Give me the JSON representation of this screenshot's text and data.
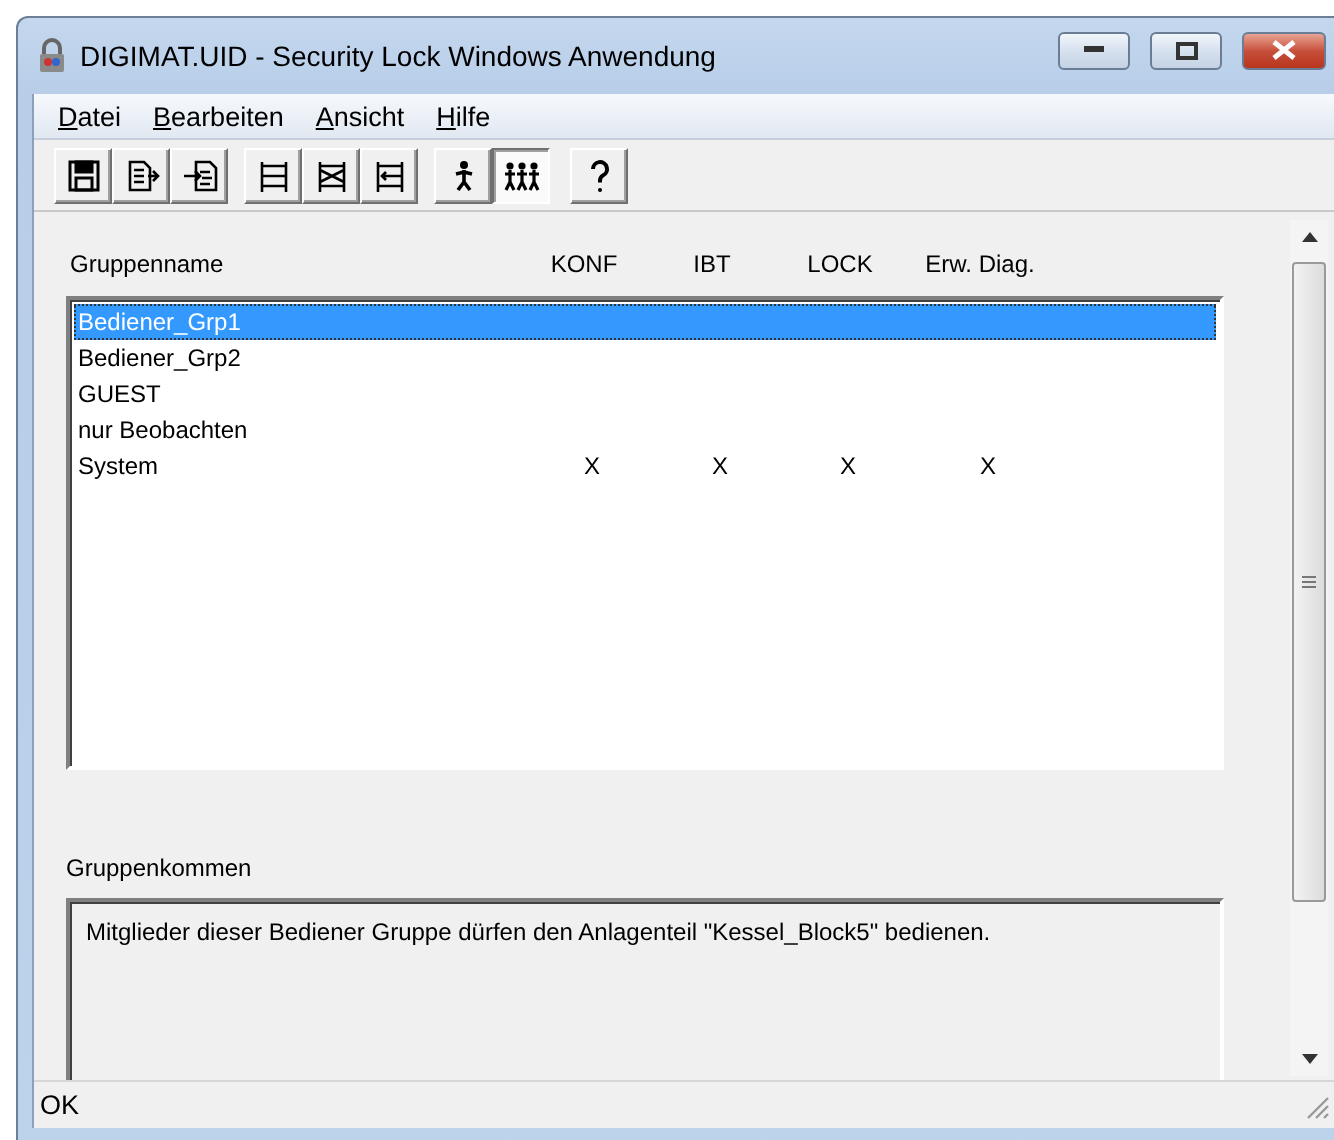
{
  "window": {
    "title": "DIGIMAT.UID - Security Lock Windows Anwendung"
  },
  "menu": [
    "Datei",
    "Bearbeiten",
    "Ansicht",
    "Hilfe"
  ],
  "toolbar": [
    {
      "kind": "save",
      "pressed": false
    },
    {
      "kind": "export",
      "pressed": false
    },
    {
      "kind": "import",
      "pressed": false
    },
    {
      "kind": "table-a",
      "pressed": false
    },
    {
      "kind": "table-b",
      "pressed": false
    },
    {
      "kind": "table-c",
      "pressed": false
    },
    {
      "kind": "user",
      "pressed": false
    },
    {
      "kind": "group",
      "pressed": true
    },
    {
      "kind": "help",
      "pressed": false
    }
  ],
  "table": {
    "columns": [
      "Gruppenname",
      "KONF",
      "IBT",
      "LOCK",
      "Erw. Diag."
    ],
    "rows": [
      {
        "cells": [
          "Bediener_Grp1",
          "",
          "",
          "",
          ""
        ],
        "selected": true
      },
      {
        "cells": [
          "Bediener_Grp2",
          "",
          "",
          "",
          ""
        ],
        "selected": false
      },
      {
        "cells": [
          "GUEST",
          "",
          "",
          "",
          ""
        ],
        "selected": false
      },
      {
        "cells": [
          "nur Beobachten",
          "",
          "",
          "",
          ""
        ],
        "selected": false
      },
      {
        "cells": [
          "System",
          "X",
          "X",
          "X",
          "X"
        ],
        "selected": false
      }
    ]
  },
  "comment": {
    "label": "Gruppenkommen",
    "text": "Mitglieder dieser Bediener Gruppe dürfen den Anlagenteil \"Kessel_Block5\" bedienen."
  },
  "status_bar": "OK"
}
